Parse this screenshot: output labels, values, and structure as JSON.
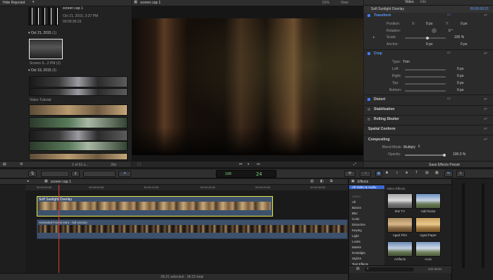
{
  "browser": {
    "filter_label": "Hide Rejected",
    "top_clip": {
      "name": "screen cap 1",
      "date": "Oct 21, 2015, 3:37 PM",
      "duration": "00:00:36:22"
    },
    "groups": [
      {
        "date": "Oct 21, 2015",
        "count": "(1)",
        "clip_label": "Screen S...2 PM (2)"
      },
      {
        "date": "Oct 19, 2015",
        "count": "(9)",
        "clip_label": "Video Tutorial"
      }
    ],
    "footer_count": "1 of 61 s...",
    "footer_duration": "30s"
  },
  "viewer": {
    "title": "screen cap 1",
    "zoom": "91%",
    "view_label": "View"
  },
  "inspector": {
    "tabs": [
      "Video",
      "Info"
    ],
    "title": "Soft Sunlight Overlay",
    "timecode": "00:00:00:21",
    "transform": {
      "label": "Transform",
      "position_label": "Position:",
      "x_label": "X:",
      "x_value": "0 px",
      "y_label": "Y:",
      "y_value": "0 px",
      "rotation_label": "Rotation:",
      "rotation_value": "0 °",
      "scale_label": "Scale:",
      "scale_value": "100 %",
      "anchor_label": "Anchor:",
      "anchor_x_value": "0 px",
      "anchor_y_value": "0 px"
    },
    "crop": {
      "label": "Crop",
      "type_label": "Type:",
      "type_value": "Trim",
      "left_label": "Left:",
      "left_value": "0 px",
      "right_label": "Right:",
      "right_value": "0 px",
      "top_label": "Top:",
      "top_value": "0 px",
      "bottom_label": "Bottom:",
      "bottom_value": "0 px"
    },
    "sections": [
      "Distort",
      "Stabilization",
      "Rolling Shutter",
      "Spatial Conform"
    ],
    "compositing": {
      "label": "Compositing",
      "blend_label": "Blend Mode:",
      "blend_value": "Multiply",
      "opacity_label": "Opacity:",
      "opacity_value": "100.0 %"
    },
    "save_preset": "Save Effects Preset"
  },
  "toolbar": {
    "timecode_display": "24",
    "percent_display": "100"
  },
  "timeline": {
    "title": "screen cap 1",
    "ruler": [
      "00:00:00:00",
      "00:00:05:00",
      "00:00:10:00",
      "00:00:15:00",
      "00:00:20:00",
      "00:00:25:00",
      "00:00:30:00",
      "00:00:35:00"
    ],
    "overlay_clip": "Soft Sunlight Overlay",
    "main_clip": "Animated Forest Intro - full version",
    "status": "06:21 selected - 36:22 total"
  },
  "effects": {
    "title": "Effects",
    "category_header": "All Video & Audio",
    "section_video": "VIDEO",
    "categories": [
      "All",
      "Basics",
      "Blur",
      "Color",
      "Distortion",
      "Keying",
      "Light",
      "Looks",
      "Masks",
      "Nostalgia",
      "Stylize",
      "Text Effects"
    ],
    "grid_header": "Video Effects",
    "items": [
      "50s TV",
      "Add Noise",
      "Aged Film",
      "Aged Paper",
      "Artifacts",
      "Aura"
    ],
    "item_count": "233 items"
  },
  "colors": {
    "accent": "#3d7fff",
    "selection": "#e6e64a",
    "playhead": "#e23b3b"
  }
}
